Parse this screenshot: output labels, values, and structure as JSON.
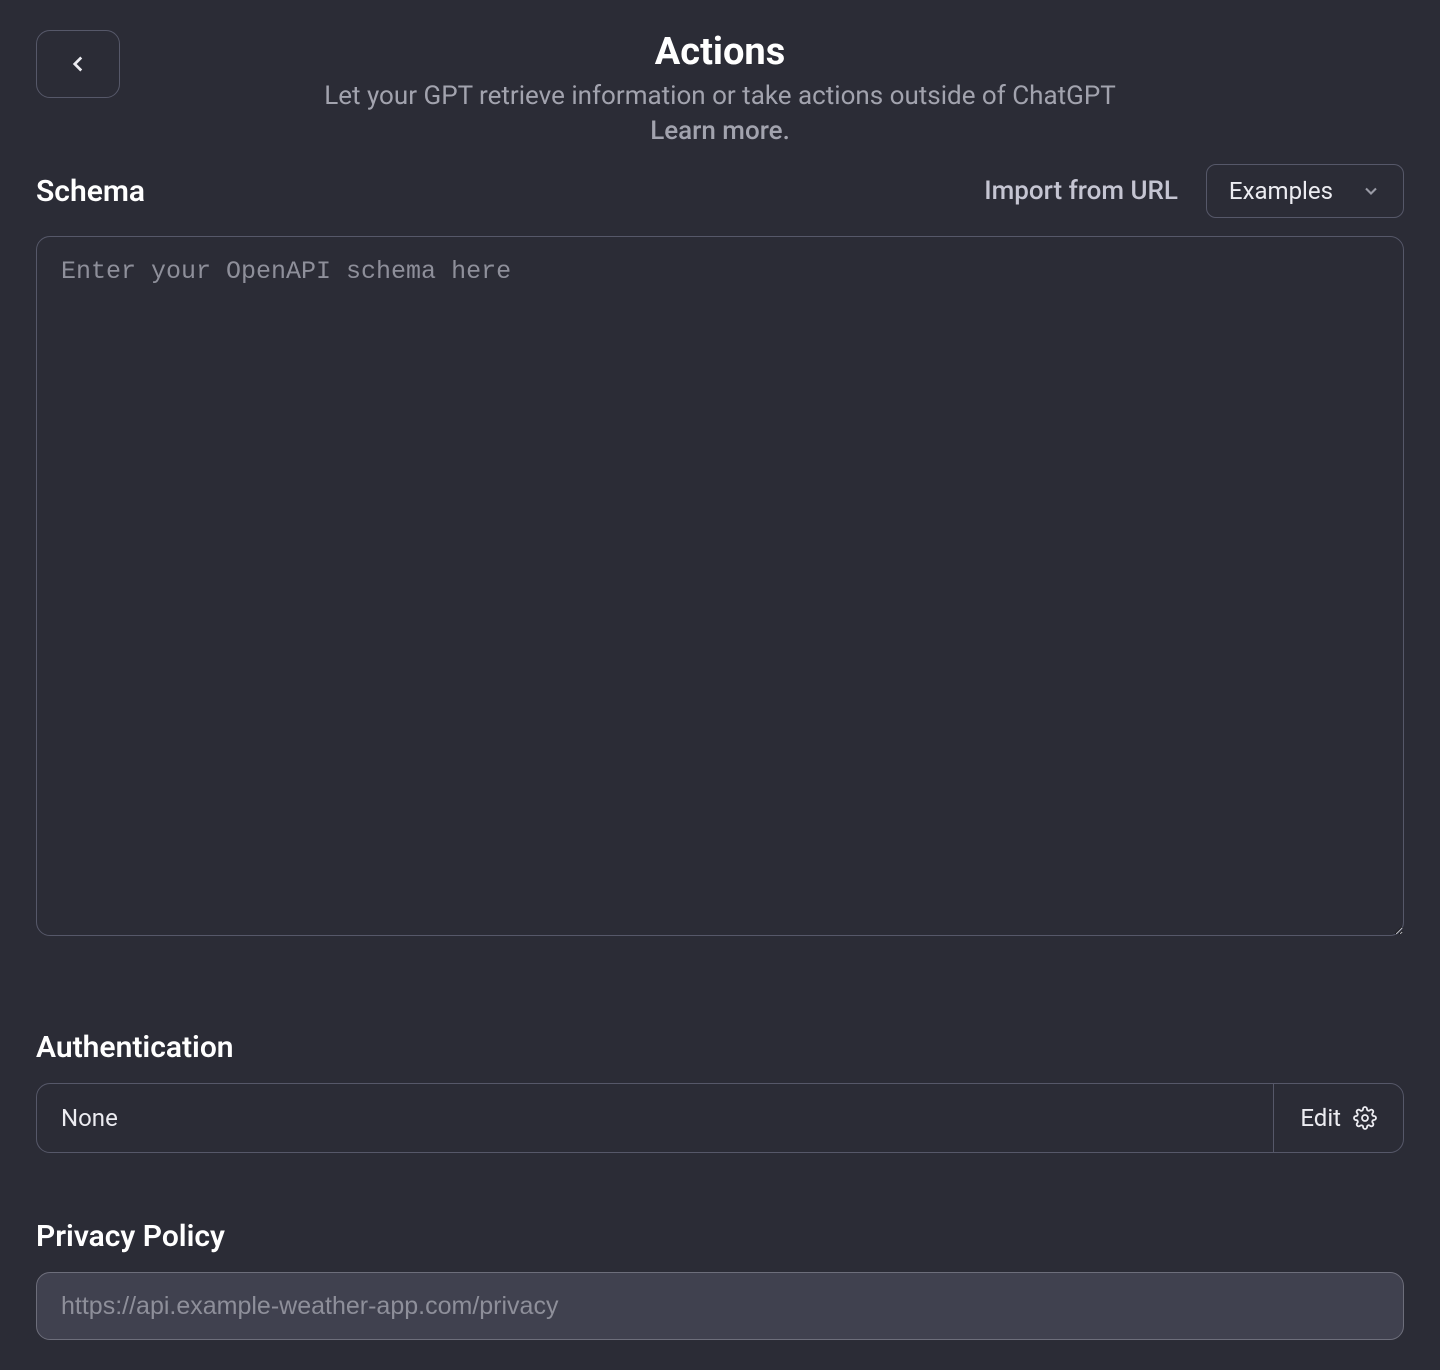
{
  "header": {
    "title": "Actions",
    "subtitle": "Let your GPT retrieve information or take actions outside of ChatGPT",
    "learn_more": "Learn more."
  },
  "schema": {
    "label": "Schema",
    "import_link": "Import from URL",
    "examples_label": "Examples",
    "placeholder": "Enter your OpenAPI schema here",
    "value": ""
  },
  "authentication": {
    "label": "Authentication",
    "value": "None",
    "edit_label": "Edit"
  },
  "privacy": {
    "label": "Privacy Policy",
    "placeholder": "https://api.example-weather-app.com/privacy",
    "value": ""
  }
}
